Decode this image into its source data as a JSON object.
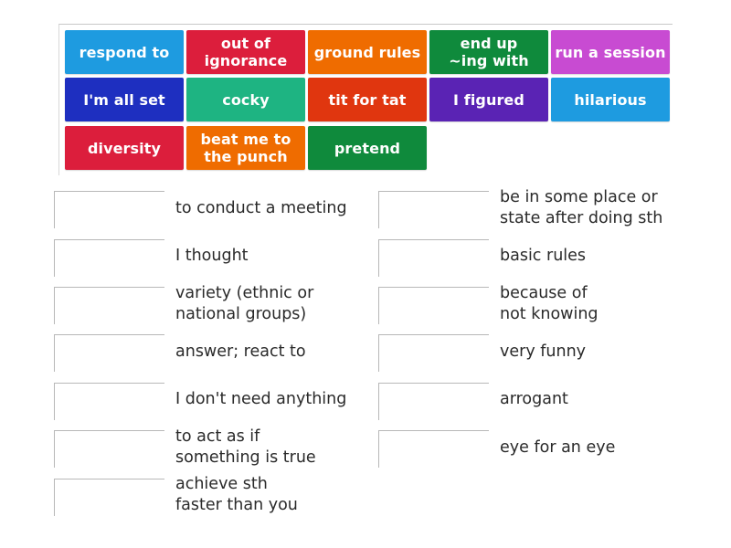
{
  "tiles": [
    {
      "label": "respond to",
      "color": "#1e9be0"
    },
    {
      "label": "out of\nignorance",
      "color": "#dc1e3c"
    },
    {
      "label": "ground rules",
      "color": "#ef6c00"
    },
    {
      "label": "end up\n~ing with",
      "color": "#0f8a3c"
    },
    {
      "label": "run a session",
      "color": "#c84bd2"
    },
    {
      "label": "I'm all set",
      "color": "#1e2fc0"
    },
    {
      "label": "cocky",
      "color": "#1eb482"
    },
    {
      "label": "tit for tat",
      "color": "#e0360f"
    },
    {
      "label": "I figured",
      "color": "#5a23b4"
    },
    {
      "label": "hilarious",
      "color": "#1e9be0"
    },
    {
      "label": "diversity",
      "color": "#dc1e3c"
    },
    {
      "label": "beat me to\nthe punch",
      "color": "#ef6c00"
    },
    {
      "label": "pretend",
      "color": "#0f8a3c"
    }
  ],
  "definitions_left": [
    "to conduct a meeting",
    "I thought",
    "variety (ethnic or\nnational groups)",
    "answer; react to",
    "I don't need anything",
    "to act as if\nsomething is true",
    "achieve sth\nfaster than you"
  ],
  "definitions_right": [
    "be in some place or\nstate after doing sth",
    "basic rules",
    "because of\nnot knowing",
    "very funny",
    "arrogant",
    "eye for an eye"
  ]
}
